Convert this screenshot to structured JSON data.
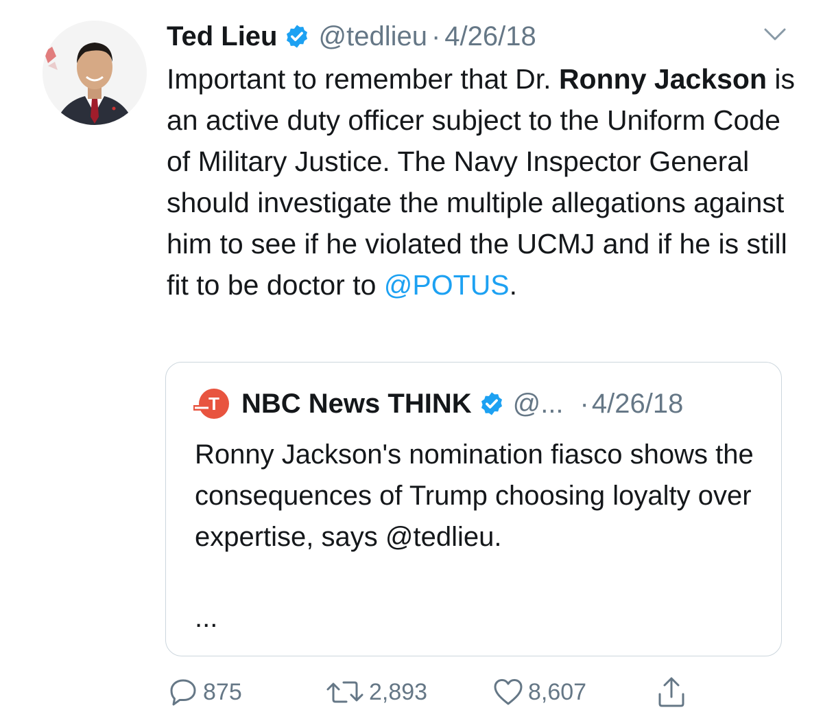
{
  "tweet": {
    "author_name": "Ted Lieu",
    "handle": "@tedlieu",
    "separator": "·",
    "date": "4/26/18",
    "text_before_bold_1": "Important to remember that Dr. ",
    "bold_1": "Ronny Jackson",
    "text_after_bold_1": " is an active duty officer subject to the Uniform Code of Military Justice. The Navy Inspector General should investigate the multiple allegations against him to see if he violated the UCMJ and if he is still fit to be doctor to ",
    "mention": "@POTUS",
    "text_end": "."
  },
  "quoted_tweet": {
    "author_name": "NBC News THINK",
    "logo_letter": "T",
    "handle": "@...",
    "separator": "·",
    "date": "4/26/18",
    "text": "Ronny Jackson's nomination fiasco shows the consequences of Trump choosing loyalty over expertise, says @tedlieu.",
    "ellipsis": "..."
  },
  "actions": {
    "replies": "875",
    "retweets": "2,893",
    "likes": "8,607"
  },
  "colors": {
    "link": "#1da1f2",
    "secondary_text": "#657786",
    "verified_badge": "#1da1f2",
    "think_logo": "#e8543f",
    "border": "#ccd6dd"
  },
  "icons": [
    "avatar",
    "verified-badge-icon",
    "chevron-down-icon",
    "think-logo-icon",
    "reply-icon",
    "retweet-icon",
    "like-icon",
    "share-icon"
  ]
}
